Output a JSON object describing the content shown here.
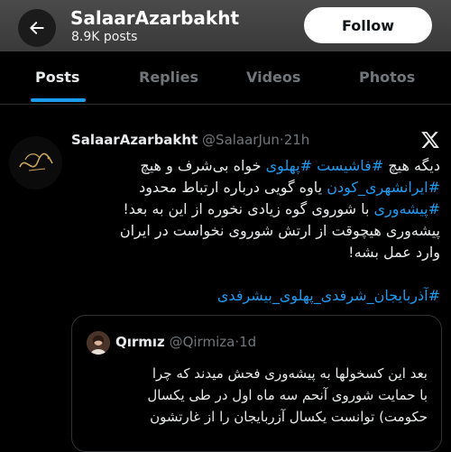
{
  "header": {
    "profile_name": "SalaarAzarbakht",
    "posts_count": "8.9K posts",
    "follow_label": "Follow"
  },
  "tabs": [
    {
      "label": "Posts",
      "active": true
    },
    {
      "label": "Replies",
      "active": false
    },
    {
      "label": "Videos",
      "active": false
    },
    {
      "label": "Photos",
      "active": false
    }
  ],
  "tweet": {
    "author": "SalaarAzarbakht",
    "handle": "@SalaarJun",
    "separator": "·",
    "time": "21h",
    "lines": [
      [
        {
          "text": "دیگه هیچ "
        },
        {
          "text": "#فاشیست",
          "tag": true
        },
        {
          "text": " "
        },
        {
          "text": "#پهلوی",
          "tag": true
        },
        {
          "text": " خواه بی‌شرف و هیچ"
        }
      ],
      [
        {
          "text": "#ایرانشهری_کودن",
          "tag": true
        },
        {
          "text": " یاوه گویی درباره ارتباط محدود"
        }
      ],
      [
        {
          "text": "#پیشه‌وری",
          "tag": true
        },
        {
          "text": " با شوروی گوه زیادی نخوره از این به بعد!"
        }
      ],
      [
        {
          "text": "پیشه‌وری هیچوقت از ارتش شوروی نخواست در ایران"
        }
      ],
      [
        {
          "text": "وارد عمل بشه!"
        }
      ]
    ],
    "hashtag_line": "#آذربایجان_شرفدی_پهلوی_بیشرفدی"
  },
  "quote": {
    "author": "Qırmız",
    "handle": "@Qirmiza",
    "separator": "·",
    "time": "1d",
    "lines": [
      "بعد این کسخولها به پیشه‌وری فحش میدند که چرا",
      "با حمایت شوروی آنحم سه ماه اول در طی یکسال",
      "حکومت) توانست یکسال آزربایجان را از غارتشون"
    ]
  },
  "colors": {
    "accent": "#1d9bf0",
    "text": "#e7e9ea",
    "muted": "#71767b",
    "background": "#000000"
  },
  "icons": [
    "back-arrow-icon",
    "x-logo-icon"
  ]
}
